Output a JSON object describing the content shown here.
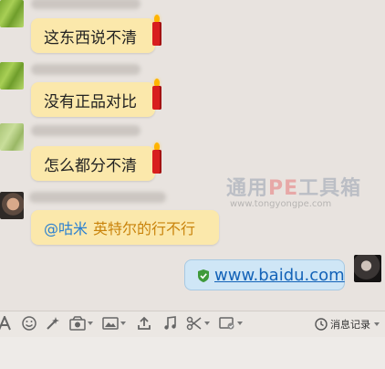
{
  "messages": [
    {
      "text": "这东西说不清"
    },
    {
      "text": "没有正品对比"
    },
    {
      "text": "怎么都分不清"
    },
    {
      "mention": "@咕米",
      "text": "英特尔的行不行"
    },
    {
      "link": "www.baidu.com"
    }
  ],
  "watermark": {
    "title_a": "通用",
    "title_pe": "PE",
    "title_b": "工具箱",
    "url": "www.tongyongpe.com"
  },
  "toolbar": {
    "history_label": "消息记录"
  },
  "colors": {
    "yellow_bubble": "#fbe8ab",
    "blue_bubble": "#cfe6f6",
    "link": "#1463b8"
  }
}
